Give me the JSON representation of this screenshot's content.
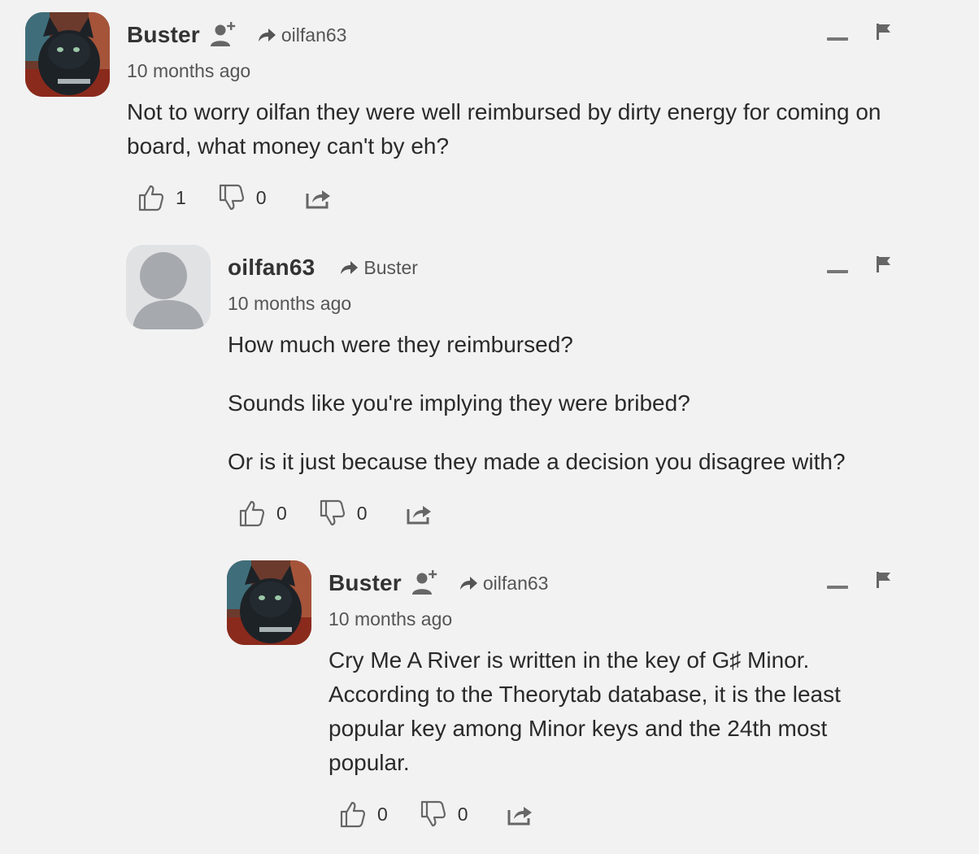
{
  "comments": [
    {
      "author": "Buster",
      "reply_to": "oilfan63",
      "time": "10 months ago",
      "paragraphs": [
        "Not to worry oilfan they were well reimbursed by dirty energy for coming on board, what money can't by eh?"
      ],
      "upvotes": "1",
      "downvotes": "0",
      "avatar": "cat-photo",
      "has_follow": true
    },
    {
      "author": "oilfan63",
      "reply_to": "Buster",
      "time": "10 months ago",
      "paragraphs": [
        "How much were they reimbursed?",
        "Sounds like you're implying they were bribed?",
        "Or is it just because they made a decision you disagree with?"
      ],
      "upvotes": "0",
      "downvotes": "0",
      "avatar": "default-avatar",
      "has_follow": false
    },
    {
      "author": "Buster",
      "reply_to": "oilfan63",
      "time": "10 months ago",
      "paragraphs": [
        "Cry Me A River is written in the key of G♯ Minor. According to the Theorytab database, it is the least popular key among Minor keys and the 24th most popular."
      ],
      "upvotes": "0",
      "downvotes": "0",
      "avatar": "cat-photo",
      "has_follow": true
    }
  ],
  "icons": {
    "follow": "add-user-icon",
    "reply": "reply-arrow-icon",
    "collapse": "minimize-icon",
    "flag": "flag-icon",
    "upvote": "thumbs-up-icon",
    "downvote": "thumbs-down-icon",
    "share": "share-icon"
  },
  "colors": {
    "background": "#f2f2f2",
    "text": "#2a2a2a",
    "muted": "#555555",
    "icon": "#666666"
  }
}
